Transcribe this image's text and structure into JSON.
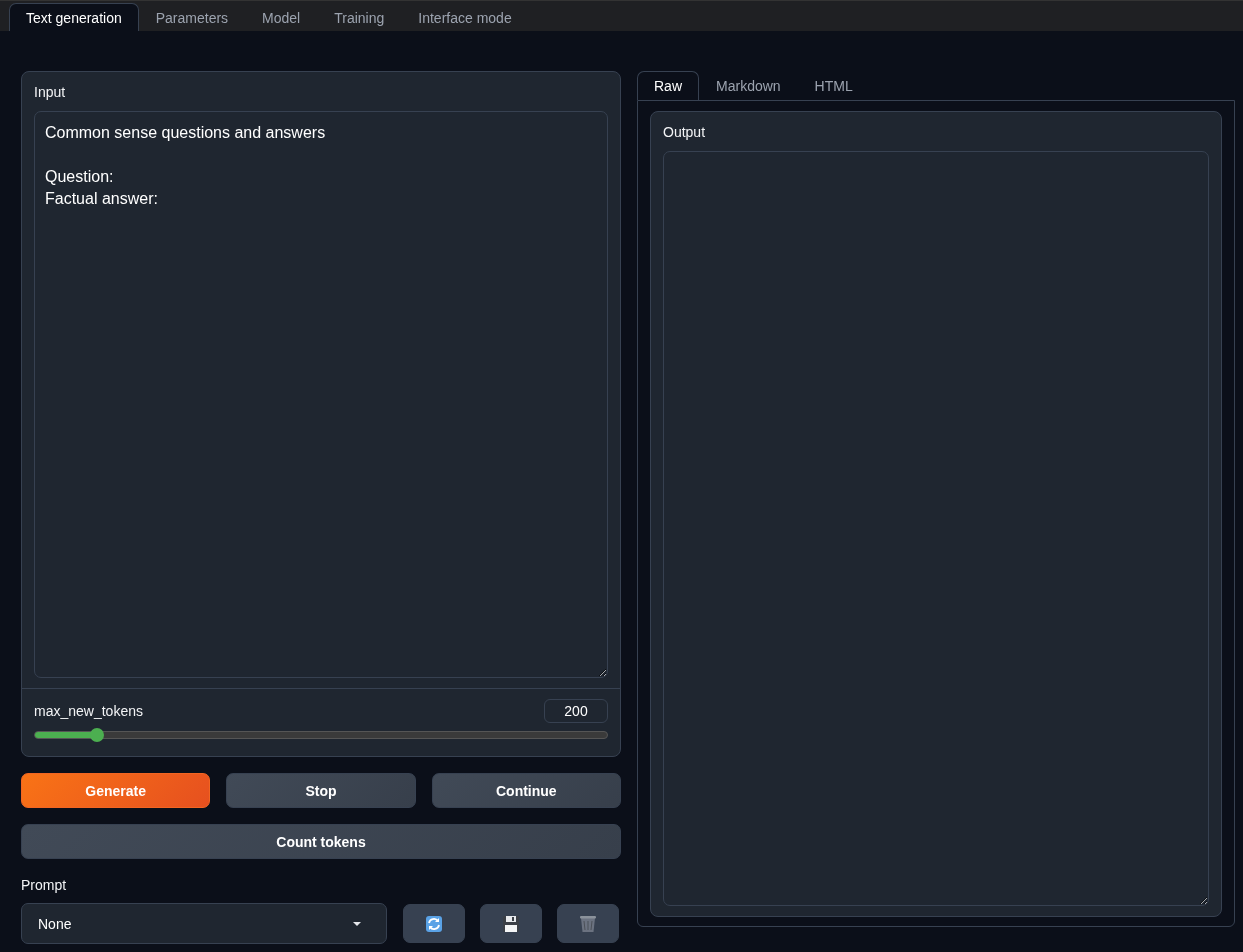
{
  "tabs": [
    {
      "label": "Text generation",
      "selected": true
    },
    {
      "label": "Parameters",
      "selected": false
    },
    {
      "label": "Model",
      "selected": false
    },
    {
      "label": "Training",
      "selected": false
    },
    {
      "label": "Interface mode",
      "selected": false
    }
  ],
  "input": {
    "label": "Input",
    "value": "Common sense questions and answers\n\nQuestion:\nFactual answer:"
  },
  "slider": {
    "label": "max_new_tokens",
    "reading": "200",
    "level": 0.108
  },
  "buttons": [
    {
      "label": "Generate",
      "kind": "primary"
    },
    {
      "label": "Stop",
      "kind": "secondary"
    },
    {
      "label": "Continue",
      "kind": "secondary"
    }
  ],
  "count_button": {
    "label": "Count tokens"
  },
  "prompt": {
    "label": "Prompt",
    "value": "None",
    "actions": [
      {
        "kind": "refresh"
      },
      {
        "kind": "save"
      },
      {
        "kind": "delete"
      }
    ]
  },
  "output_tabs": [
    {
      "label": "Raw",
      "selected": true
    },
    {
      "label": "Markdown",
      "selected": false
    },
    {
      "label": "HTML",
      "selected": false
    }
  ],
  "output": {
    "label": "Output"
  }
}
